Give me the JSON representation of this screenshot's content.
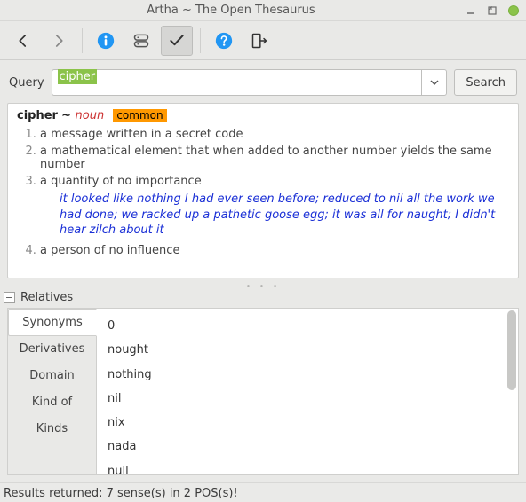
{
  "window": {
    "title": "Artha ~ The Open Thesaurus"
  },
  "query": {
    "label": "Query",
    "value": "cipher",
    "search_label": "Search"
  },
  "entry": {
    "word": "cipher",
    "pos": "noun",
    "freq": "common"
  },
  "definitions": [
    "a message written in a secret code",
    "a mathematical element that when added to another number yields the same number",
    "a quantity of no importance",
    "a person of no influence"
  ],
  "example_for_3": "it looked like nothing I had ever seen before; reduced to nil all the work we had done; we racked up a pathetic goose egg; it was all for naught; I didn't hear zilch about it",
  "relatives": {
    "heading": "Relatives",
    "tabs": [
      "Synonyms",
      "Derivatives",
      "Domain",
      "Kind of",
      "Kinds"
    ],
    "active_tab_index": 0,
    "synonyms": [
      "0",
      "nought",
      "nothing",
      "nil",
      "nix",
      "nada",
      "null"
    ]
  },
  "status": "Results returned: 7 sense(s) in 2 POS(s)!"
}
